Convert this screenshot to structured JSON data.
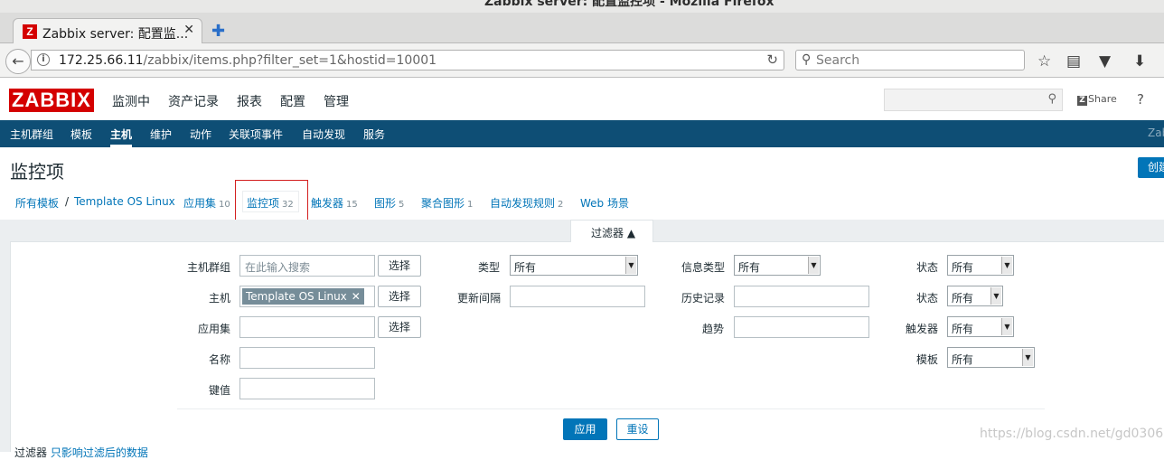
{
  "window": {
    "title": "Zabbix server: 配置监控项 - Mozilla Firefox"
  },
  "browser": {
    "tab_title": "Zabbix server: 配置监...",
    "tab_close": "✕",
    "new_tab": "✚",
    "url_host": "172.25.66.11",
    "url_path": "/zabbix/items.php?filter_set=1&hostid=10001",
    "search_placeholder": "Search"
  },
  "header": {
    "logo": "ZABBIX",
    "menu": [
      "监测中",
      "资产记录",
      "报表",
      "配置",
      "管理"
    ],
    "share": "Share",
    "help": "?"
  },
  "subnav": {
    "items": [
      "主机群组",
      "模板",
      "主机",
      "维护",
      "动作",
      "关联项事件",
      "自动发现",
      "服务"
    ],
    "right": "Zab"
  },
  "page": {
    "title": "监控项",
    "create_button": "创建监控项"
  },
  "breadcrumb": {
    "all_templates": "所有模板",
    "sep": "/",
    "template": "Template OS Linux",
    "tabs": [
      {
        "label": "应用集",
        "count": "10"
      },
      {
        "label": "监控项",
        "count": "32"
      },
      {
        "label": "触发器",
        "count": "15"
      },
      {
        "label": "图形",
        "count": "5"
      },
      {
        "label": "聚合图形",
        "count": "1"
      },
      {
        "label": "自动发现规则",
        "count": "2"
      },
      {
        "label": "Web 场景",
        "count": ""
      }
    ]
  },
  "filter": {
    "tab_label": "过滤器 ▲",
    "host_group_label": "主机群组",
    "host_group_placeholder": "在此输入搜索",
    "select_label": "选择",
    "host_label": "主机",
    "host_chip": "Template OS Linux",
    "application_label": "应用集",
    "name_label": "名称",
    "key_label": "键值",
    "type_label": "类型",
    "type_value": "所有",
    "interval_label": "更新间隔",
    "info_type_label": "信息类型",
    "info_type_value": "所有",
    "history_label": "历史记录",
    "trends_label": "趋势",
    "status_label": "状态",
    "status_value": "所有",
    "state_label": "状态",
    "state_value": "所有",
    "triggers_label": "触发器",
    "triggers_value": "所有",
    "template_label": "模板",
    "template_value": "所有",
    "apply": "应用",
    "reset": "重设"
  },
  "footer": {
    "filter_prefix": "过滤器",
    "filter_link": "只影响过滤后的数据"
  },
  "watermark": "https://blog.csdn.net/gd0306"
}
